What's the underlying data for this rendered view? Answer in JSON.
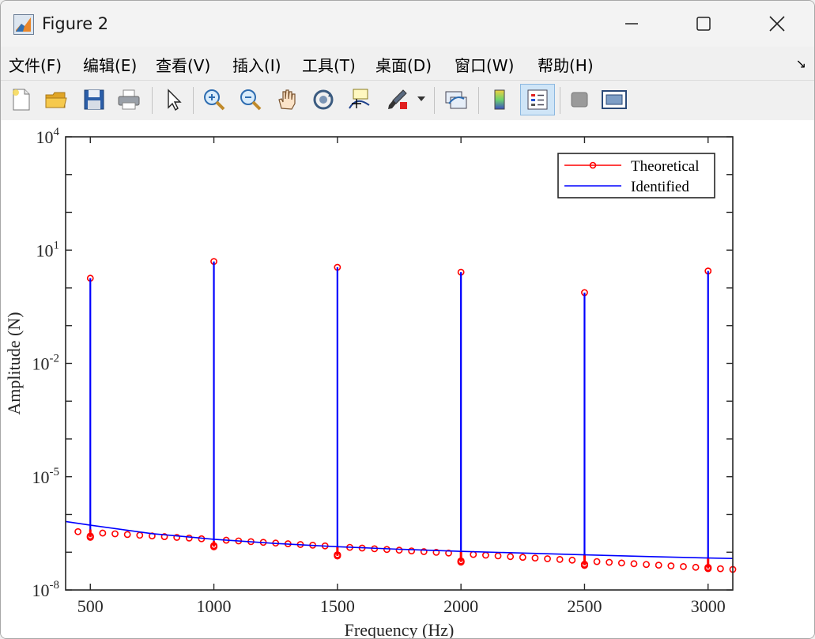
{
  "window": {
    "title": "Figure 2",
    "minimize_label": "minimize",
    "maximize_label": "maximize",
    "close_label": "close"
  },
  "menu": [
    {
      "label": "文件(F)"
    },
    {
      "label": "编辑(E)"
    },
    {
      "label": "查看(V)"
    },
    {
      "label": "插入(I)"
    },
    {
      "label": "工具(T)"
    },
    {
      "label": "桌面(D)"
    },
    {
      "label": "窗口(W)"
    },
    {
      "label": "帮助(H)"
    }
  ],
  "toolbar": {
    "icons": [
      "new-figure-icon",
      "open-file-icon",
      "save-icon",
      "print-icon",
      "select-arrow-icon",
      "zoom-in-icon",
      "zoom-out-icon",
      "pan-hand-icon",
      "rotate-3d-icon",
      "data-cursor-icon",
      "brush-icon",
      "brush-dropdown-icon",
      "link-plot-icon",
      "colorbar-icon",
      "legend-icon",
      "hide-plot-tools-icon",
      "show-plot-tools-icon"
    ],
    "active": "legend-icon"
  },
  "chart_data": {
    "type": "line",
    "title": "",
    "xlabel": "Frequency (Hz)",
    "ylabel": "Amplitude (N)",
    "xlim": [
      400,
      3100
    ],
    "ylim_log10": [
      -8,
      4
    ],
    "yscale": "log",
    "x_ticks": [
      500,
      1000,
      1500,
      2000,
      2500,
      3000
    ],
    "y_tick_exponents": [
      4,
      1,
      -2,
      -5,
      -8
    ],
    "legend_position": "top-right",
    "legend": [
      "Theoretical",
      "Identified"
    ],
    "colors": {
      "theoretical": "#ff0000",
      "identified": "#0000ff"
    },
    "peaks": [
      {
        "x": 500,
        "theoretical": 1.8,
        "identified": 1.8,
        "base_theoretical": 2.5e-07,
        "base_identified": 4e-07
      },
      {
        "x": 1000,
        "theoretical": 5.0,
        "identified": 5.0,
        "base_theoretical": 1.4e-07,
        "base_identified": 2e-07
      },
      {
        "x": 1500,
        "theoretical": 3.5,
        "identified": 3.5,
        "base_theoretical": 8e-08,
        "base_identified": 1.4e-07
      },
      {
        "x": 2000,
        "theoretical": 2.6,
        "identified": 2.6,
        "base_theoretical": 5.5e-08,
        "base_identified": 1.1e-07
      },
      {
        "x": 2500,
        "theoretical": 0.75,
        "identified": 0.75,
        "base_theoretical": 4.5e-08,
        "base_identified": 8.5e-08
      },
      {
        "x": 3000,
        "theoretical": 2.8,
        "identified": 2.8,
        "base_theoretical": 3.7e-08,
        "base_identified": 7e-08
      }
    ],
    "theoretical_floor": {
      "x_start": 450,
      "x_end": 3100,
      "x_step": 50,
      "y_at_450": 3.5e-07,
      "y_at_3100": 3.5e-08
    },
    "identified_floor": {
      "x": [
        400,
        500,
        750,
        1000,
        1250,
        1500,
        1750,
        2000,
        2250,
        2500,
        2750,
        3000,
        3100
      ],
      "y": [
        6.5e-07,
        5.2e-07,
        3.1e-07,
        2.2e-07,
        1.7e-07,
        1.4e-07,
        1.2e-07,
        1.05e-07,
        9.5e-08,
        8.5e-08,
        7.7e-08,
        7e-08,
        6.8e-08
      ]
    }
  }
}
